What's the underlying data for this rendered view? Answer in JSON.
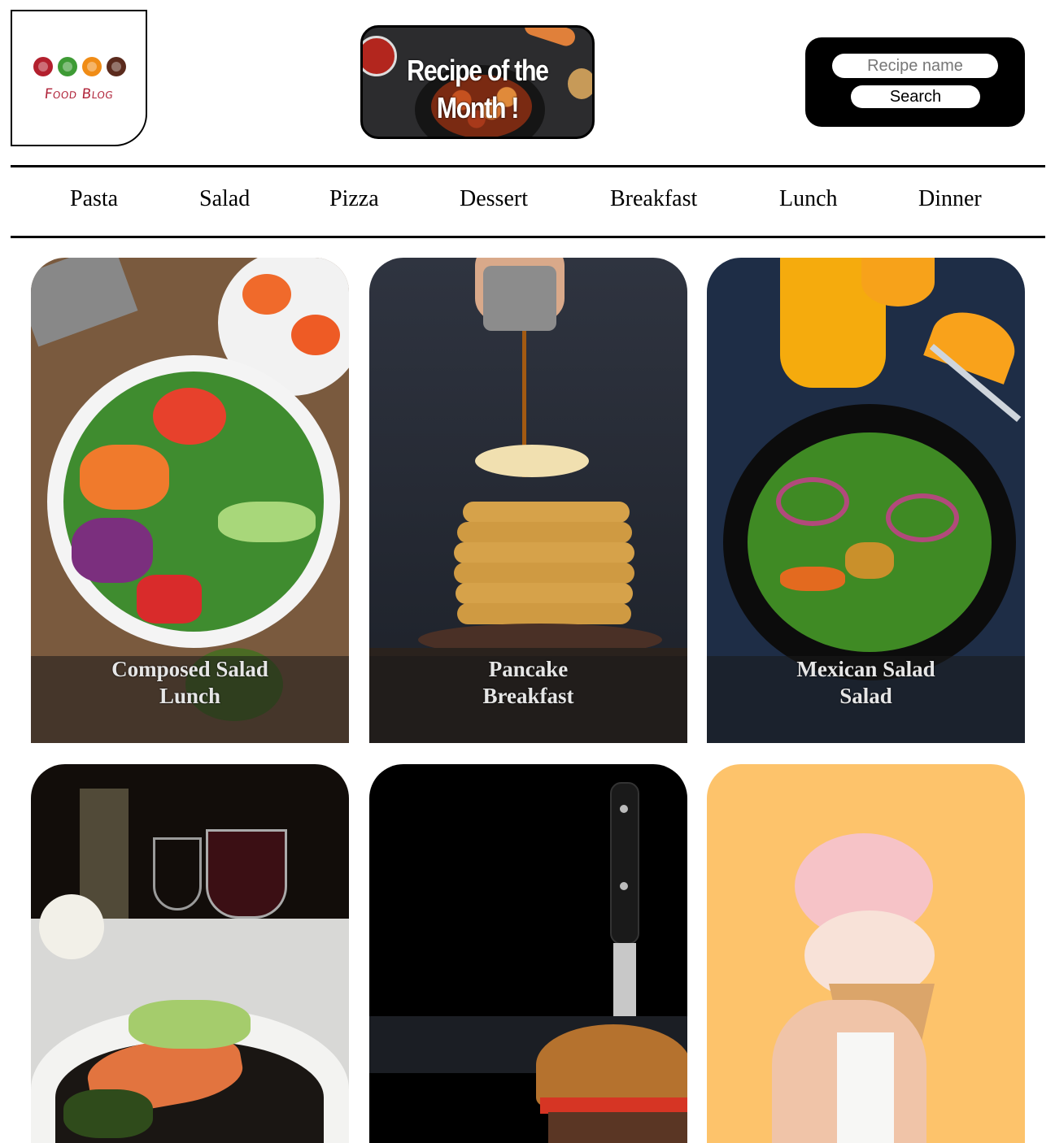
{
  "header": {
    "logo_text": "Food Blog",
    "logo_dot_colors": [
      "#b3202e",
      "#3e9b35",
      "#f08c16",
      "#5b2b1d"
    ],
    "feature_title_line1": "Recipe of the",
    "feature_title_line2": "Month !",
    "search": {
      "placeholder": "Recipe name",
      "button_label": "Search"
    }
  },
  "nav": {
    "items": [
      {
        "label": "Pasta"
      },
      {
        "label": "Salad"
      },
      {
        "label": "Pizza"
      },
      {
        "label": "Dessert"
      },
      {
        "label": "Breakfast"
      },
      {
        "label": "Lunch"
      },
      {
        "label": "Dinner"
      }
    ]
  },
  "cards": [
    {
      "name": "Composed Salad",
      "category": "Lunch"
    },
    {
      "name": "Pancake",
      "category": "Breakfast"
    },
    {
      "name": "Mexican Salad",
      "category": "Salad"
    },
    {
      "name": "",
      "category": ""
    },
    {
      "name": "",
      "category": ""
    },
    {
      "name": "",
      "category": ""
    }
  ]
}
